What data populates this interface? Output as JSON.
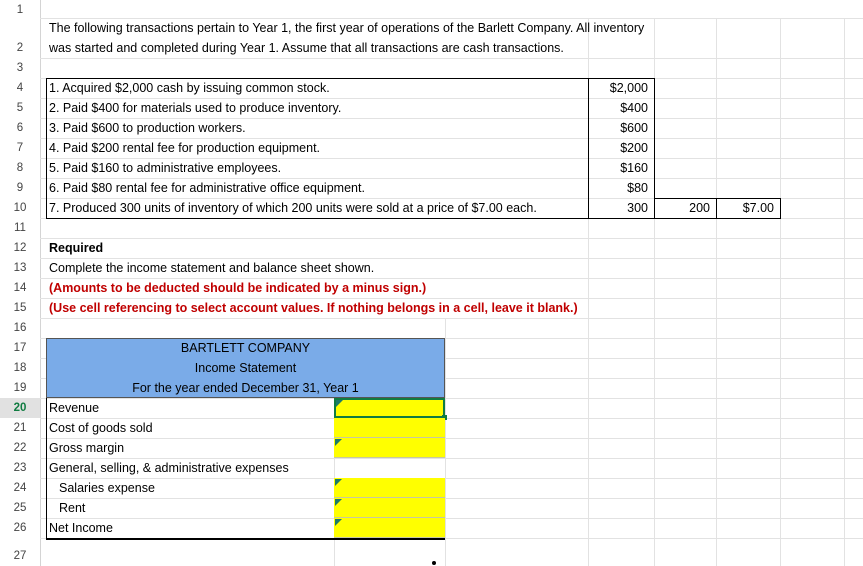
{
  "row_numbers": [
    "1",
    "2",
    "3",
    "4",
    "5",
    "6",
    "7",
    "8",
    "9",
    "10",
    "11",
    "12",
    "13",
    "14",
    "15",
    "16",
    "17",
    "18",
    "19",
    "20",
    "21",
    "22",
    "23",
    "24",
    "25",
    "26",
    "27"
  ],
  "intro": {
    "line1": "The following transactions pertain to Year 1, the first year of operations of the Barlett Company. All inventory",
    "line2": "was started and completed during Year 1. Assume that all transactions are cash transactions."
  },
  "transactions": [
    {
      "text": "1. Acquired $2,000 cash by issuing common stock.",
      "amount": "$2,000"
    },
    {
      "text": "2. Paid $400 for materials used to produce inventory.",
      "amount": "$400"
    },
    {
      "text": "3. Paid $600 to production workers.",
      "amount": "$600"
    },
    {
      "text": "4. Paid $200 rental fee for production equipment.",
      "amount": "$200"
    },
    {
      "text": "5. Paid $160 to administrative employees.",
      "amount": "$160"
    },
    {
      "text": "6. Paid $80 rental fee for administrative office equipment.",
      "amount": "$80"
    },
    {
      "text": "7. Produced 300 units of inventory of which 200 units were sold at a price of $7.00 each.",
      "amount": "300",
      "units_sold": "200",
      "price": "$7.00"
    }
  ],
  "required": {
    "heading": "Required",
    "instruction": "Complete the income statement and balance sheet shown.",
    "note1": "(Amounts to be deducted should be indicated by a minus sign.)",
    "note2": "(Use cell referencing to select account values. If nothing belongs in a cell, leave it blank.)"
  },
  "statement": {
    "company": "BARTLETT COMPANY",
    "title": "Income Statement",
    "period": "For the year ended December 31, Year 1",
    "lines": [
      {
        "label": "Revenue",
        "indent": false
      },
      {
        "label": "Cost of goods sold",
        "indent": false
      },
      {
        "label": "Gross margin",
        "indent": false
      },
      {
        "label": "General, selling, & administrative expenses",
        "indent": false
      },
      {
        "label": "Salaries expense",
        "indent": true
      },
      {
        "label": "Rent",
        "indent": true
      },
      {
        "label": "Net Income",
        "indent": false
      }
    ]
  },
  "colors": {
    "header_band": "#7aabe8",
    "input_fill": "#ffff00",
    "note_red": "#c00000",
    "active_green": "#107c41"
  }
}
